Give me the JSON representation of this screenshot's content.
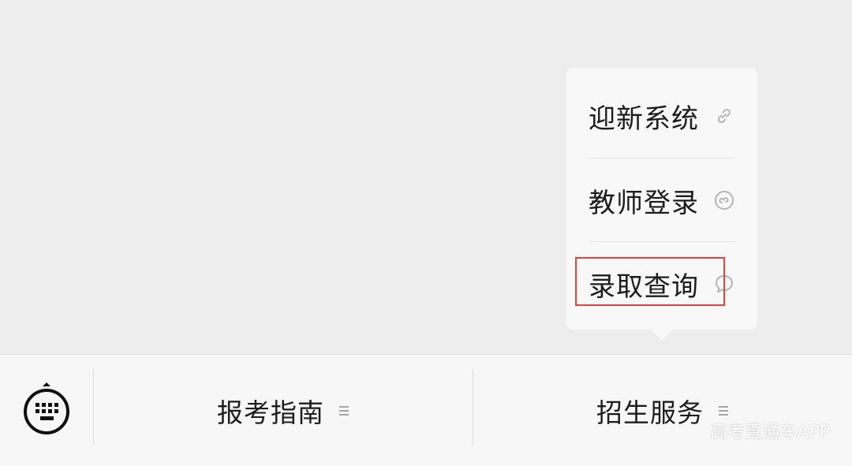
{
  "popup_menu": {
    "items": [
      {
        "label": "迎新系统",
        "icon": "link-icon"
      },
      {
        "label": "教师登录",
        "icon": "mini-program-icon"
      },
      {
        "label": "录取查询",
        "icon": "chat-bubble-icon"
      }
    ]
  },
  "bottom_menu": {
    "keyboard_icon": "keyboard-icon",
    "tabs": [
      {
        "label": "报考指南",
        "icon": "menu-lines-icon"
      },
      {
        "label": "招生服务",
        "icon": "menu-lines-icon"
      }
    ]
  },
  "watermark": "高考直通车APP",
  "colors": {
    "background": "#ededed",
    "popup": "#f8f8f8",
    "highlight": "#e94040",
    "bar": "#f7f7f7"
  }
}
